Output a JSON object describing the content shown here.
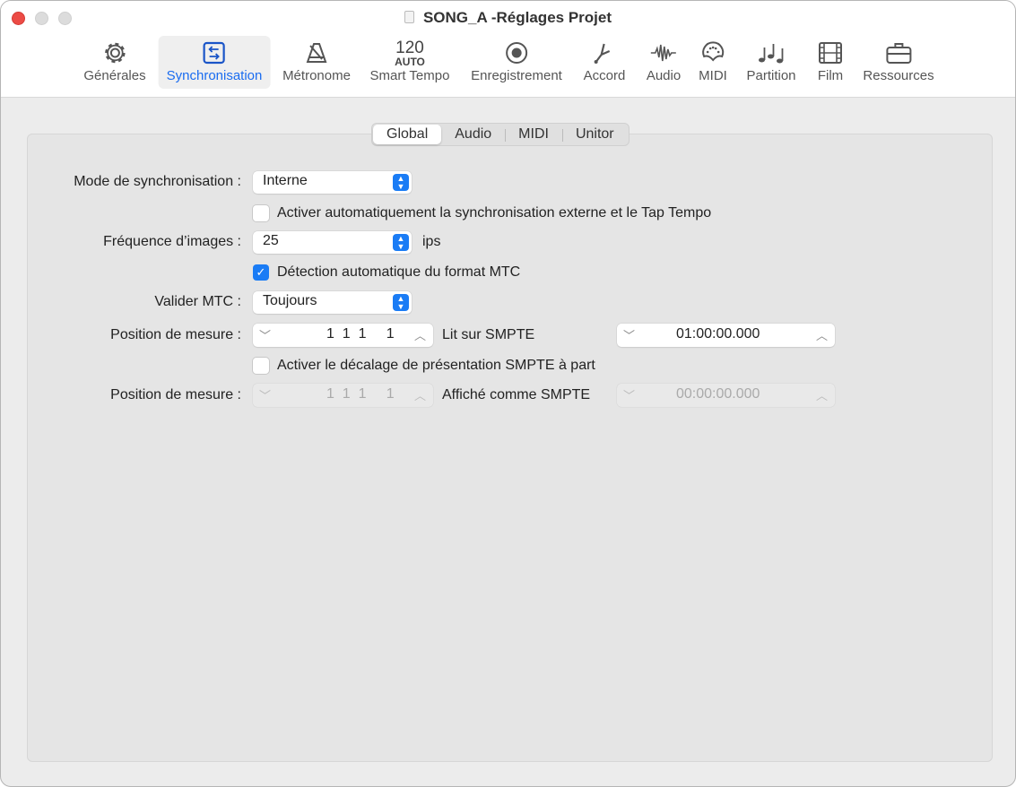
{
  "window": {
    "title": "SONG_A -Réglages Projet"
  },
  "toolbar": [
    {
      "label": "Générales",
      "icon": "gear-icon"
    },
    {
      "label": "Synchronisation",
      "icon": "sync-arrows-icon",
      "selected": true
    },
    {
      "label": "Métronome",
      "icon": "metronome-icon"
    },
    {
      "label": "Smart Tempo",
      "icon": "tempo-icon",
      "icon_text": "120",
      "icon_subtext": "AUTO"
    },
    {
      "label": "Enregistrement",
      "icon": "record-icon"
    },
    {
      "label": "Accord",
      "icon": "tuning-fork-icon"
    },
    {
      "label": "Audio",
      "icon": "waveform-icon"
    },
    {
      "label": "MIDI",
      "icon": "midi-port-icon"
    },
    {
      "label": "Partition",
      "icon": "notes-icon"
    },
    {
      "label": "Film",
      "icon": "film-icon"
    },
    {
      "label": "Ressources",
      "icon": "briefcase-icon"
    }
  ],
  "tabs": [
    "Global",
    "Audio",
    "MIDI",
    "Unitor"
  ],
  "form": {
    "sync_mode_label": "Mode de synchronisation :",
    "sync_mode_value": "Interne",
    "auto_external_label": "Activer automatiquement la synchronisation externe et le Tap Tempo",
    "auto_external_checked": false,
    "frame_rate_label": "Fréquence d’images :",
    "frame_rate_value": "25",
    "frame_rate_unit": "ips",
    "auto_mtc_label": "Détection automatique du format MTC",
    "auto_mtc_checked": true,
    "validate_mtc_label": "Valider MTC :",
    "validate_mtc_value": "Toujours",
    "bar_position_label": "Position de mesure :",
    "bar_position_value": "1  1  1     1",
    "plays_at_smpte_label": "Lit sur SMPTE",
    "plays_at_smpte_value": "01:00:00.000",
    "separate_offset_label": "Activer le décalage de présentation SMPTE à part",
    "separate_offset_checked": false,
    "bar_position2_label": "Position de mesure :",
    "bar_position2_value": "1  1  1     1",
    "displayed_as_smpte_label": "Affiché comme SMPTE",
    "displayed_as_smpte_value": "00:00:00.000"
  },
  "colors": {
    "accent": "#1a7cf5",
    "close": "#ec4b45"
  }
}
